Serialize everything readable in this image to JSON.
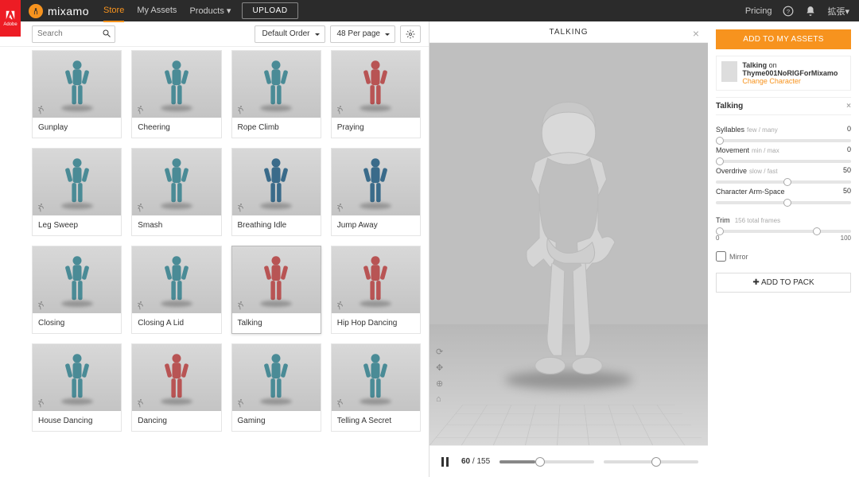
{
  "adobe_label": "Adobe",
  "logo": "mixamo",
  "nav": {
    "store": "Store",
    "assets": "My Assets",
    "products": "Products",
    "upload": "UPLOAD",
    "pricing": "Pricing",
    "user": "拡張"
  },
  "search": {
    "placeholder": "Search"
  },
  "sort": {
    "order": "Default Order",
    "per_page": "48 Per page"
  },
  "cards": [
    {
      "label": "Gunplay",
      "c": "blue"
    },
    {
      "label": "Cheering",
      "c": "blue"
    },
    {
      "label": "Rope Climb",
      "c": "blue"
    },
    {
      "label": "Praying",
      "c": "red"
    },
    {
      "label": "Leg Sweep",
      "c": "blue"
    },
    {
      "label": "Smash",
      "c": "blue"
    },
    {
      "label": "Breathing Idle",
      "c": "blue2"
    },
    {
      "label": "Jump Away",
      "c": "blue2"
    },
    {
      "label": "Closing",
      "c": "blue"
    },
    {
      "label": "Closing A Lid",
      "c": "blue"
    },
    {
      "label": "Talking",
      "c": "red",
      "sel": true
    },
    {
      "label": "Hip Hop Dancing",
      "c": "red"
    },
    {
      "label": "House Dancing",
      "c": "blue"
    },
    {
      "label": "Dancing",
      "c": "red"
    },
    {
      "label": "Gaming",
      "c": "blue"
    },
    {
      "label": "Telling A Secret",
      "c": "blue"
    }
  ],
  "viewer": {
    "title": "TALKING",
    "add": "ADD TO MY ASSETS",
    "on": " on ",
    "name": "Talking",
    "char": "Thyme001NoRIGForMixamo",
    "change": "Change Character"
  },
  "panel": {
    "head": "Talking",
    "p": [
      {
        "label": "Syllables",
        "hint": "few / many",
        "val": "0",
        "pos": 0
      },
      {
        "label": "Movement",
        "hint": "min / max",
        "val": "0",
        "pos": 0
      },
      {
        "label": "Overdrive",
        "hint": "slow / fast",
        "val": "50",
        "pos": 50
      },
      {
        "label": "Character Arm-Space",
        "hint": "",
        "val": "50",
        "pos": 50
      }
    ],
    "trim": {
      "label": "Trim",
      "hint": "156 total frames",
      "a": "0",
      "b": "100"
    },
    "mirror": "Mirror",
    "pack": "ADD TO PACK"
  },
  "play": {
    "cur": "60",
    "total": "155"
  }
}
